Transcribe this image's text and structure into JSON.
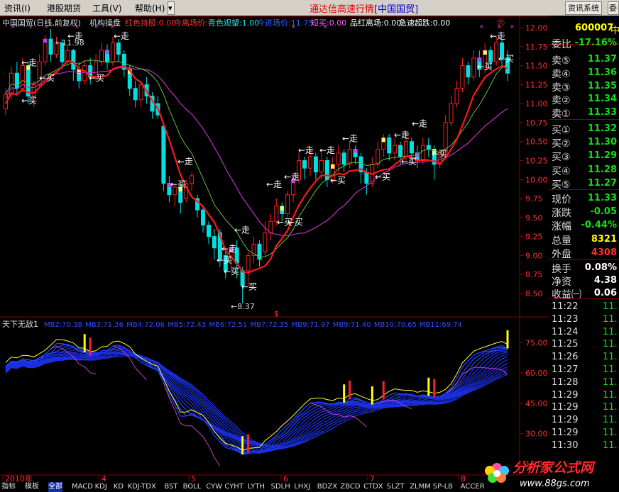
{
  "menu": {
    "items": [
      "资讯(I)",
      "港股期货",
      "工具(V)",
      "帮助(H)"
    ],
    "title": "通达信高速行情",
    "title_bracket": "[中国国贸]",
    "btn1": "资讯系统",
    "btn2": "委"
  },
  "header": {
    "stock": "中国国贸(日线,前复权)",
    "indicator": "机构操盘",
    "items": [
      {
        "label": "红色持股:0.00",
        "color": "#ff3030"
      },
      {
        "label": "今离场价:-",
        "color": "#ff3030"
      },
      {
        "label": "青色观望:1.00",
        "color": "#30e0e0"
      },
      {
        "label": "今进场价:11.75",
        "color": "#3060ff"
      },
      {
        "label": "短买:0.00",
        "color": "#ff60ff"
      },
      {
        "label": "品红离场:0.00",
        "color": "#ffffff"
      },
      {
        "label": "急速超跌:0.00",
        "color": "#ffffff"
      }
    ]
  },
  "lower_header": {
    "name": "天下无敌1",
    "items": [
      "MB2:70.38",
      "MB3:71.36",
      "MB4:72.06",
      "MB5:72.43",
      "MB6:72.51",
      "MB7:72.35",
      "MB9:71.97",
      "MB9:71.40",
      "MB10:70.65",
      "MB11:69.74"
    ]
  },
  "chart_data": [
    {
      "type": "candlestick",
      "ylim": [
        8.5,
        12.0
      ],
      "y_ticks": [
        "12.00",
        "11.75",
        "11.50",
        "11.25",
        "11.00",
        "10.75",
        "10.50",
        "10.25",
        "10.00",
        "9.75",
        "9.50",
        "9.25",
        "9.00",
        "8.75",
        "8.50"
      ],
      "x_labels": [
        "2010年",
        "4",
        "5",
        "6",
        "7",
        "8"
      ],
      "annotations": {
        "low": "←8.37",
        "high": "←11.98",
        "dollar": "$"
      },
      "signals": [
        {
          "label": "←走",
          "x": 30,
          "y": 11.5
        },
        {
          "label": "←走",
          "x": 95,
          "y": 11.85
        },
        {
          "label": "←走",
          "x": 160,
          "y": 11.85
        },
        {
          "label": "←买",
          "x": 30,
          "y": 11.0
        },
        {
          "label": "←买",
          "x": 55,
          "y": 11.3
        },
        {
          "label": "←买",
          "x": 125,
          "y": 11.3
        },
        {
          "label": "←走",
          "x": 250,
          "y": 10.2
        },
        {
          "label": "←买",
          "x": 240,
          "y": 9.9
        },
        {
          "label": "←走",
          "x": 330,
          "y": 9.3
        },
        {
          "label": "←走",
          "x": 312,
          "y": 9.05
        },
        {
          "label": "←买",
          "x": 305,
          "y": 8.9
        },
        {
          "label": "←买",
          "x": 315,
          "y": 8.75
        },
        {
          "label": "←买",
          "x": 340,
          "y": 8.55
        },
        {
          "label": "←走",
          "x": 375,
          "y": 9.9
        },
        {
          "label": "←走",
          "x": 400,
          "y": 10.0
        },
        {
          "label": "←走",
          "x": 420,
          "y": 10.35
        },
        {
          "label": "←走",
          "x": 450,
          "y": 10.35
        },
        {
          "label": "←走",
          "x": 482,
          "y": 10.5
        },
        {
          "label": "←买",
          "x": 390,
          "y": 9.4
        },
        {
          "label": "←买",
          "x": 405,
          "y": 9.4
        },
        {
          "label": "←买",
          "x": 465,
          "y": 9.95
        },
        {
          "label": "←买",
          "x": 528,
          "y": 10.0
        },
        {
          "label": "←走",
          "x": 555,
          "y": 10.55
        },
        {
          "label": "←走",
          "x": 580,
          "y": 10.7
        },
        {
          "label": "←买",
          "x": 565,
          "y": 10.2
        },
        {
          "label": "←买",
          "x": 608,
          "y": 10.3
        },
        {
          "label": "←走",
          "x": 690,
          "y": 11.85
        },
        {
          "label": "←买",
          "x": 672,
          "y": 11.45
        },
        {
          "label": "←买",
          "x": 702,
          "y": 11.55
        }
      ],
      "candles": [
        [
          10.93,
          11.12,
          10.85,
          11.2
        ],
        [
          11.12,
          11.4,
          11.05,
          11.48
        ],
        [
          11.4,
          11.2,
          11.1,
          11.55
        ],
        [
          11.2,
          11.5,
          11.15,
          11.6
        ],
        [
          11.5,
          11.1,
          11.0,
          11.55
        ],
        [
          11.1,
          11.25,
          10.95,
          11.3
        ],
        [
          11.25,
          11.55,
          11.2,
          11.65
        ],
        [
          11.55,
          11.85,
          11.5,
          11.9
        ],
        [
          11.85,
          11.65,
          11.55,
          11.98
        ],
        [
          11.65,
          11.8,
          11.6,
          11.88
        ],
        [
          11.8,
          11.55,
          11.45,
          11.85
        ],
        [
          11.55,
          11.7,
          11.5,
          11.78
        ],
        [
          11.7,
          11.45,
          11.3,
          11.72
        ],
        [
          11.45,
          11.3,
          11.2,
          11.55
        ],
        [
          11.3,
          11.5,
          11.25,
          11.58
        ],
        [
          11.5,
          11.35,
          11.25,
          11.6
        ],
        [
          11.35,
          11.55,
          11.3,
          11.65
        ],
        [
          11.55,
          11.7,
          11.5,
          11.8
        ],
        [
          11.7,
          11.55,
          11.45,
          11.78
        ],
        [
          11.55,
          11.8,
          11.5,
          11.88
        ],
        [
          11.8,
          11.65,
          11.55,
          11.85
        ],
        [
          11.65,
          11.45,
          11.35,
          11.7
        ],
        [
          11.45,
          11.2,
          11.1,
          11.5
        ],
        [
          11.2,
          11.05,
          10.95,
          11.3
        ],
        [
          11.05,
          11.25,
          10.95,
          11.3
        ],
        [
          11.25,
          11.1,
          11.0,
          11.35
        ],
        [
          11.1,
          10.9,
          10.8,
          11.15
        ],
        [
          11.0,
          10.85,
          10.8,
          11.1
        ],
        [
          10.7,
          9.95,
          9.85,
          10.75
        ],
        [
          9.95,
          9.8,
          9.7,
          10.05
        ],
        [
          9.8,
          9.9,
          9.65,
          9.95
        ],
        [
          9.9,
          9.7,
          9.55,
          9.95
        ],
        [
          9.75,
          9.95,
          9.7,
          10.0
        ],
        [
          9.95,
          10.05,
          9.85,
          10.1
        ],
        [
          9.75,
          9.6,
          9.5,
          9.8
        ],
        [
          9.6,
          9.4,
          9.3,
          9.65
        ],
        [
          9.4,
          9.25,
          9.15,
          9.45
        ],
        [
          9.25,
          9.1,
          8.95,
          9.35
        ],
        [
          9.3,
          8.95,
          8.85,
          9.35
        ],
        [
          9.0,
          8.8,
          8.7,
          9.05
        ],
        [
          8.95,
          9.1,
          8.8,
          9.15
        ],
        [
          9.1,
          8.9,
          8.7,
          9.2
        ],
        [
          8.8,
          8.6,
          8.37,
          8.85
        ],
        [
          8.8,
          9.0,
          8.6,
          9.05
        ],
        [
          9.0,
          9.15,
          8.9,
          9.25
        ],
        [
          9.15,
          8.95,
          8.85,
          9.2
        ],
        [
          9.05,
          9.3,
          9.0,
          9.45
        ],
        [
          9.3,
          9.45,
          9.2,
          9.55
        ],
        [
          9.45,
          9.65,
          9.4,
          9.75
        ],
        [
          9.65,
          9.55,
          9.45,
          9.7
        ],
        [
          9.55,
          9.8,
          9.5,
          9.85
        ],
        [
          9.8,
          10.0,
          9.7,
          10.05
        ],
        [
          10.0,
          10.25,
          9.95,
          10.35
        ],
        [
          10.25,
          10.15,
          10.0,
          10.3
        ],
        [
          10.15,
          10.3,
          10.05,
          10.4
        ],
        [
          10.3,
          10.1,
          10.0,
          10.35
        ],
        [
          10.1,
          10.25,
          10.0,
          10.35
        ],
        [
          10.25,
          10.0,
          9.9,
          10.3
        ],
        [
          10.0,
          10.2,
          9.95,
          10.3
        ],
        [
          10.2,
          10.35,
          10.1,
          10.45
        ],
        [
          10.35,
          10.2,
          10.1,
          10.4
        ],
        [
          10.2,
          10.4,
          10.15,
          10.5
        ],
        [
          10.4,
          10.3,
          10.2,
          10.45
        ],
        [
          10.3,
          10.1,
          9.95,
          10.35
        ],
        [
          10.1,
          9.95,
          9.8,
          10.15
        ],
        [
          9.95,
          10.2,
          9.9,
          10.3
        ],
        [
          10.2,
          10.4,
          10.15,
          10.5
        ],
        [
          10.4,
          10.55,
          10.3,
          10.6
        ],
        [
          10.55,
          10.35,
          10.25,
          10.6
        ],
        [
          10.35,
          10.45,
          10.25,
          10.55
        ],
        [
          10.45,
          10.3,
          10.2,
          10.5
        ],
        [
          10.3,
          10.5,
          10.25,
          10.6
        ],
        [
          10.5,
          10.35,
          10.25,
          10.55
        ],
        [
          10.35,
          10.25,
          10.15,
          10.45
        ],
        [
          10.25,
          10.45,
          10.2,
          10.55
        ],
        [
          10.45,
          10.4,
          10.3,
          10.55
        ],
        [
          10.4,
          10.2,
          10.0,
          10.45
        ],
        [
          10.2,
          10.35,
          10.15,
          10.4
        ],
        [
          10.35,
          10.75,
          10.3,
          10.85
        ],
        [
          10.75,
          11.0,
          10.7,
          11.1
        ],
        [
          11.0,
          11.2,
          10.95,
          11.3
        ],
        [
          11.2,
          11.5,
          11.15,
          11.6
        ],
        [
          11.5,
          11.35,
          11.25,
          11.55
        ],
        [
          11.35,
          11.6,
          11.3,
          11.7
        ],
        [
          11.6,
          11.45,
          11.35,
          11.7
        ],
        [
          11.45,
          11.7,
          11.4,
          11.8
        ],
        [
          11.7,
          11.55,
          11.45,
          11.75
        ],
        [
          11.55,
          11.8,
          11.5,
          11.88
        ],
        [
          11.8,
          11.6,
          11.5,
          11.85
        ],
        [
          11.6,
          11.4,
          11.3,
          11.7
        ]
      ]
    },
    {
      "type": "line",
      "ylim": [
        15,
        80
      ],
      "y_ticks": [
        "75.00",
        "60.00",
        "45.00",
        "30.00",
        "15.00"
      ]
    }
  ],
  "side": {
    "code": "600007",
    "name": "中",
    "weibi": {
      "label": "委比",
      "value": "-17.16%"
    },
    "asks": [
      {
        "label": "卖⑤",
        "value": "11.37"
      },
      {
        "label": "卖④",
        "value": "11.36"
      },
      {
        "label": "卖③",
        "value": "11.35"
      },
      {
        "label": "卖②",
        "value": "11.34"
      },
      {
        "label": "卖①",
        "value": "11.33"
      }
    ],
    "bids": [
      {
        "label": "买①",
        "value": "11.32"
      },
      {
        "label": "买②",
        "value": "11.30"
      },
      {
        "label": "买③",
        "value": "11.29"
      },
      {
        "label": "买④",
        "value": "11.28"
      },
      {
        "label": "买⑤",
        "value": "11.27"
      }
    ],
    "stats": [
      {
        "label": "现价",
        "value": "11.33",
        "color": "#10e010"
      },
      {
        "label": "涨跌",
        "value": "-0.05",
        "color": "#10e010"
      },
      {
        "label": "涨幅",
        "value": "-0.44%",
        "color": "#10e010"
      },
      {
        "label": "总量",
        "value": "8321",
        "color": "#ffff00"
      },
      {
        "label": "外盘",
        "value": "4308",
        "color": "#ff3030"
      }
    ],
    "stats2": [
      {
        "label": "换手",
        "value": "0.08%"
      },
      {
        "label": "净资",
        "value": "4.38"
      },
      {
        "label": "收益㈠",
        "value": "0.06"
      }
    ],
    "ticks": [
      {
        "time": "11:22",
        "price": "11."
      },
      {
        "time": "11:23",
        "price": "11."
      },
      {
        "time": "11:24",
        "price": "11."
      },
      {
        "time": "11:25",
        "price": "11."
      },
      {
        "time": "11:26",
        "price": "11."
      },
      {
        "time": "11:27",
        "price": "11."
      },
      {
        "time": "11:28",
        "price": "11."
      },
      {
        "time": "11:29",
        "price": "11."
      },
      {
        "time": "11:29",
        "price": "11."
      },
      {
        "time": "11:29",
        "price": "11."
      },
      {
        "time": "11:29",
        "price": "11."
      },
      {
        "time": "11:30",
        "price": "11."
      }
    ]
  },
  "tabs": [
    "指标",
    "模板",
    "全部",
    "MACD",
    "KDJ",
    "KD",
    "KDJ-TDX",
    "BST",
    "BOLL",
    "CYW",
    "CYHT",
    "LYTH",
    "SDLH",
    "LHXJ",
    "BDZX",
    "ZBCD",
    "CTDX",
    "SLZT",
    "ZLMM",
    "SP-LB",
    "ACCER"
  ],
  "watermark": {
    "text": "分析家公式网",
    "url": "www.88gs.com"
  },
  "colors": {
    "up": "#ff2020",
    "down": "#00e0e0",
    "ma_red": "#ff1818",
    "ma_magenta": "#c030c0",
    "ma_green": "#60c040",
    "panel_border": "#880000",
    "axis_text": "#ff3030"
  }
}
